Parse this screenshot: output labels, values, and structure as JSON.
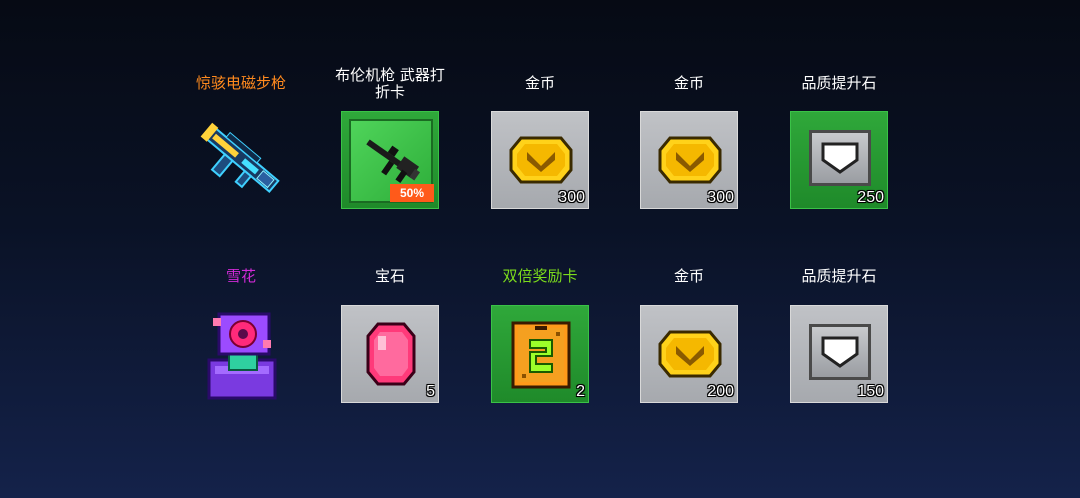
{
  "rows": [
    {
      "items": [
        {
          "label": "惊骇电磁步枪",
          "label_color": "orange",
          "icon": "rifle-icon"
        },
        {
          "label": "布伦机枪 武器打折卡",
          "label_color": "white",
          "icon": "machine-gun-icon",
          "discount": "50%"
        },
        {
          "label": "金币",
          "label_color": "white",
          "icon": "gold-coin-icon",
          "count": "300"
        },
        {
          "label": "金币",
          "label_color": "white",
          "icon": "gold-coin-icon",
          "count": "300"
        },
        {
          "label": "品质提升石",
          "label_color": "white",
          "icon": "quality-stone-icon",
          "count": "250"
        }
      ]
    },
    {
      "items": [
        {
          "label": "雪花",
          "label_color": "purple",
          "icon": "snowflake-chest-icon"
        },
        {
          "label": "宝石",
          "label_color": "white",
          "icon": "gem-icon",
          "count": "5"
        },
        {
          "label": "双倍奖励卡",
          "label_color": "green",
          "icon": "double-reward-card-icon",
          "count": "2"
        },
        {
          "label": "金币",
          "label_color": "white",
          "icon": "gold-coin-icon",
          "count": "200"
        },
        {
          "label": "品质提升石",
          "label_color": "white",
          "icon": "quality-stone-icon",
          "count": "150"
        }
      ]
    }
  ],
  "colors": {
    "orange": "#ff8a1e",
    "purple": "#d02ad6",
    "green": "#7cdc1c",
    "white": "#ffffff"
  }
}
